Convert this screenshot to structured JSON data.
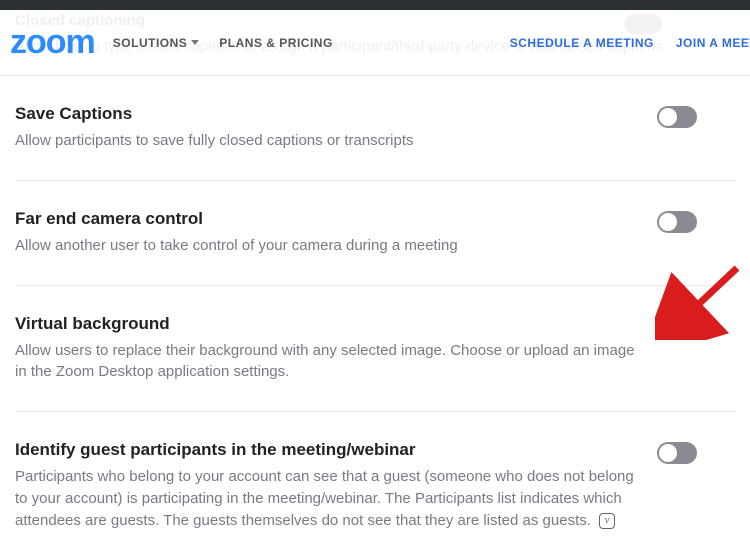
{
  "ghost": {
    "title": "Closed captioning",
    "desc": "Allow host to type closed captions or assign a participant/third party device to add closed captions"
  },
  "nav": {
    "logo": "zoom",
    "solutions": "SOLUTIONS",
    "plans": "PLANS & PRICING",
    "schedule": "SCHEDULE A MEETING",
    "join": "JOIN A MEETING"
  },
  "settings": [
    {
      "title": "Save Captions",
      "desc": "Allow participants to save fully closed captions or transcripts",
      "on": false,
      "help": false
    },
    {
      "title": "Far end camera control",
      "desc": "Allow another user to take control of your camera during a meeting",
      "on": false,
      "help": false
    },
    {
      "title": "Virtual background",
      "desc": "Allow users to replace their background with any selected image. Choose or upload an image in the Zoom Desktop application settings.",
      "on": true,
      "help": false
    },
    {
      "title": "Identify guest participants in the meeting/webinar",
      "desc": "Participants who belong to your account can see that a guest (someone who does not belong to your account) is participating in the meeting/webinar. The Participants list indicates which attendees are guests. The guests themselves do not see that they are listed as guests.",
      "on": false,
      "help": true
    }
  ],
  "helpGlyph": "v"
}
